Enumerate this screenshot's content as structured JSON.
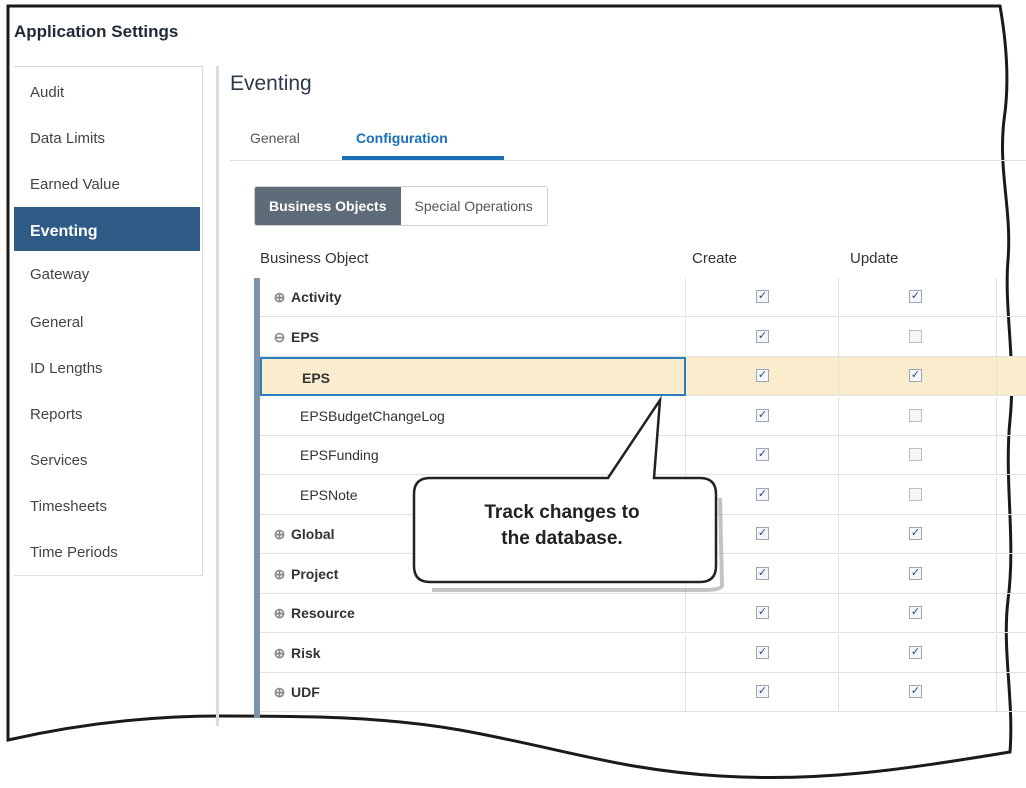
{
  "app": {
    "title": "Application Settings"
  },
  "sidebar": {
    "items": [
      {
        "label": "Audit",
        "active": false
      },
      {
        "label": "Data Limits",
        "active": false
      },
      {
        "label": "Earned Value",
        "active": false
      },
      {
        "label": "Eventing",
        "active": true
      },
      {
        "label": "Gateway",
        "active": false
      },
      {
        "label": "General",
        "active": false
      },
      {
        "label": "ID Lengths",
        "active": false
      },
      {
        "label": "Reports",
        "active": false
      },
      {
        "label": "Services",
        "active": false
      },
      {
        "label": "Timesheets",
        "active": false
      },
      {
        "label": "Time Periods",
        "active": false
      }
    ]
  },
  "main": {
    "heading": "Eventing",
    "tabs": [
      {
        "label": "General",
        "active": false
      },
      {
        "label": "Configuration",
        "active": true
      }
    ],
    "segments": [
      {
        "label": "Business Objects",
        "active": true
      },
      {
        "label": "Special Operations",
        "active": false
      }
    ],
    "columns": {
      "name": "Business Object",
      "create": "Create",
      "update": "Update"
    },
    "rows": [
      {
        "label": "Activity",
        "expander": "⊕",
        "bold": true,
        "child": false,
        "create": true,
        "update": true
      },
      {
        "label": "EPS",
        "expander": "⊖",
        "bold": true,
        "child": false,
        "create": true,
        "update": false
      },
      {
        "label": "EPS",
        "expander": "",
        "bold": true,
        "child": true,
        "create": true,
        "update": true,
        "selected": true
      },
      {
        "label": "EPSBudgetChangeLog",
        "expander": "",
        "bold": false,
        "child": true,
        "create": true,
        "update": false
      },
      {
        "label": "EPSFunding",
        "expander": "",
        "bold": false,
        "child": true,
        "create": true,
        "update": false
      },
      {
        "label": "EPSNote",
        "expander": "",
        "bold": false,
        "child": true,
        "create": true,
        "update": false
      },
      {
        "label": "Global",
        "expander": "⊕",
        "bold": true,
        "child": false,
        "create": true,
        "update": true
      },
      {
        "label": "Project",
        "expander": "⊕",
        "bold": true,
        "child": false,
        "create": true,
        "update": true
      },
      {
        "label": "Resource",
        "expander": "⊕",
        "bold": true,
        "child": false,
        "create": true,
        "update": true
      },
      {
        "label": "Risk",
        "expander": "⊕",
        "bold": true,
        "child": false,
        "create": true,
        "update": true
      },
      {
        "label": "UDF",
        "expander": "⊕",
        "bold": true,
        "child": false,
        "create": true,
        "update": true
      }
    ]
  },
  "callout": {
    "line1": "Track changes to",
    "line2": "the database."
  },
  "colors": {
    "accent": "#1a6fb7",
    "active_nav": "#2e5a86",
    "selected_row": "#fbeccd"
  }
}
